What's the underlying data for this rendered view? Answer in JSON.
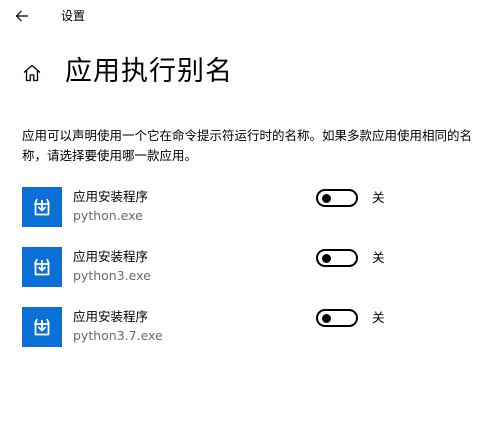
{
  "titlebar": {
    "app_title": "设置"
  },
  "header": {
    "title": "应用执行别名"
  },
  "description": "应用可以声明使用一个它在命令提示符运行时的名称。如果多款应用使用相同的名称，请选择要使用哪一款应用。",
  "aliases": [
    {
      "name": "应用安装程序",
      "executable": "python.exe",
      "enabled": false,
      "state_label": "关"
    },
    {
      "name": "应用安装程序",
      "executable": "python3.exe",
      "enabled": false,
      "state_label": "关"
    },
    {
      "name": "应用安装程序",
      "executable": "python3.7.exe",
      "enabled": false,
      "state_label": "关"
    }
  ],
  "colors": {
    "app_tile": "#0a6fd6",
    "secondary_text": "#6b6b6b"
  },
  "icons": {
    "back": "arrow-left-icon",
    "home": "home-icon",
    "app": "package-box-icon"
  }
}
